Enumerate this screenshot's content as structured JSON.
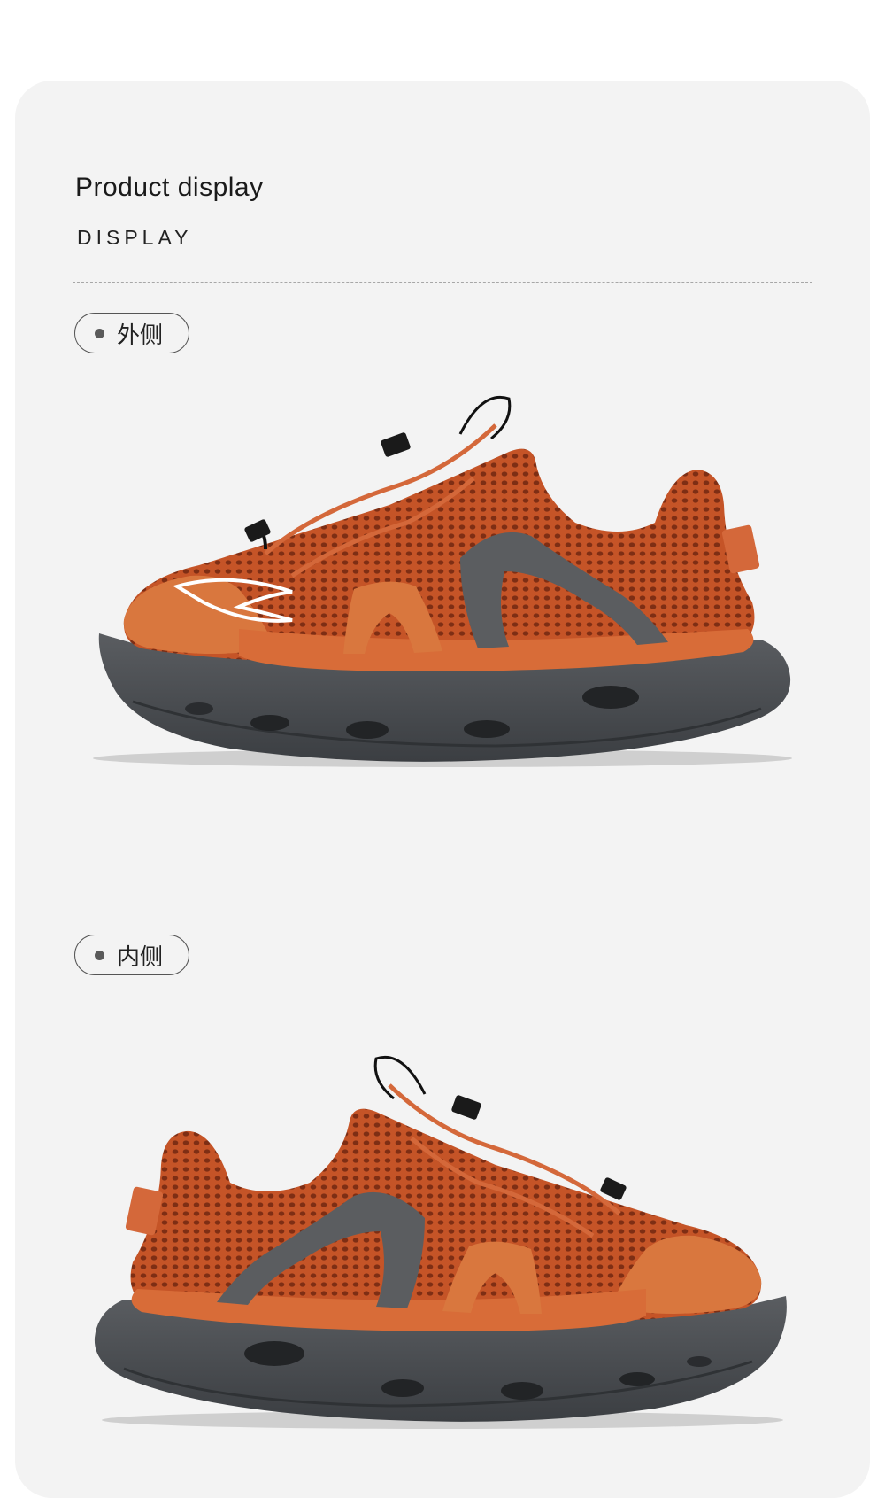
{
  "header": {
    "title": "Product display",
    "subtitle": "DISPLAY"
  },
  "sections": [
    {
      "label": "外侧"
    },
    {
      "label": "内侧"
    }
  ],
  "colors": {
    "card_background": "#f3f3f3",
    "shoe_upper": "#c8582b",
    "shoe_suede": "#d9773e",
    "sole": "#4a4d50",
    "strap": "#5b5d60"
  }
}
